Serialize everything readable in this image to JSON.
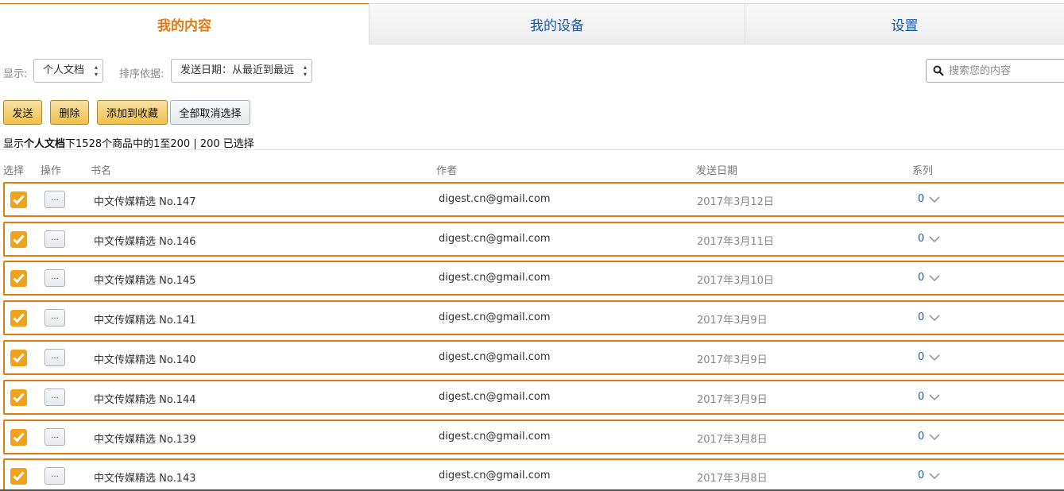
{
  "tabs": [
    {
      "label": "我的内容",
      "active": true
    },
    {
      "label": "我的设备",
      "active": false
    },
    {
      "label": "设置",
      "active": false
    }
  ],
  "filters": {
    "show_label": "显示:",
    "show_value": "个人文档",
    "sort_label": "排序依据:",
    "sort_value": "发送日期：从最近到最远"
  },
  "search": {
    "placeholder": "搜索您的内容",
    "icon": "search-icon"
  },
  "actions": {
    "send": "发送",
    "delete": "删除",
    "add_favorites": "添加到收藏",
    "deselect_all": "全部取消选择"
  },
  "summary": {
    "prefix": "显示",
    "category": "个人文档",
    "suffix": "下1528个商品中的1至200 | 200 已选择"
  },
  "columns": {
    "select": "选择",
    "action": "操作",
    "title": "书名",
    "author": "作者",
    "date": "发送日期",
    "series": "系列"
  },
  "rows": [
    {
      "title": "中文传媒精选 No.147",
      "author": "digest.cn@gmail.com",
      "date": "2017年3月12日",
      "series": "0",
      "more": "...",
      "selected": true
    },
    {
      "title": "中文传媒精选 No.146",
      "author": "digest.cn@gmail.com",
      "date": "2017年3月11日",
      "series": "0",
      "more": "...",
      "selected": true
    },
    {
      "title": "中文传媒精选 No.145",
      "author": "digest.cn@gmail.com",
      "date": "2017年3月10日",
      "series": "0",
      "more": "...",
      "selected": true
    },
    {
      "title": "中文传媒精选 No.141",
      "author": "digest.cn@gmail.com",
      "date": "2017年3月9日",
      "series": "0",
      "more": "...",
      "selected": true
    },
    {
      "title": "中文传媒精选 No.140",
      "author": "digest.cn@gmail.com",
      "date": "2017年3月9日",
      "series": "0",
      "more": "...",
      "selected": true
    },
    {
      "title": "中文传媒精选 No.144",
      "author": "digest.cn@gmail.com",
      "date": "2017年3月9日",
      "series": "0",
      "more": "...",
      "selected": true
    },
    {
      "title": "中文传媒精选 No.139",
      "author": "digest.cn@gmail.com",
      "date": "2017年3月8日",
      "series": "0",
      "more": "...",
      "selected": true
    },
    {
      "title": "中文传媒精选 No.143",
      "author": "digest.cn@gmail.com",
      "date": "2017年3月8日",
      "series": "0",
      "more": "...",
      "selected": true
    }
  ],
  "colors": {
    "accent": "#e47911",
    "checkbox": "#f1a21b",
    "link": "#1a5aa6"
  }
}
